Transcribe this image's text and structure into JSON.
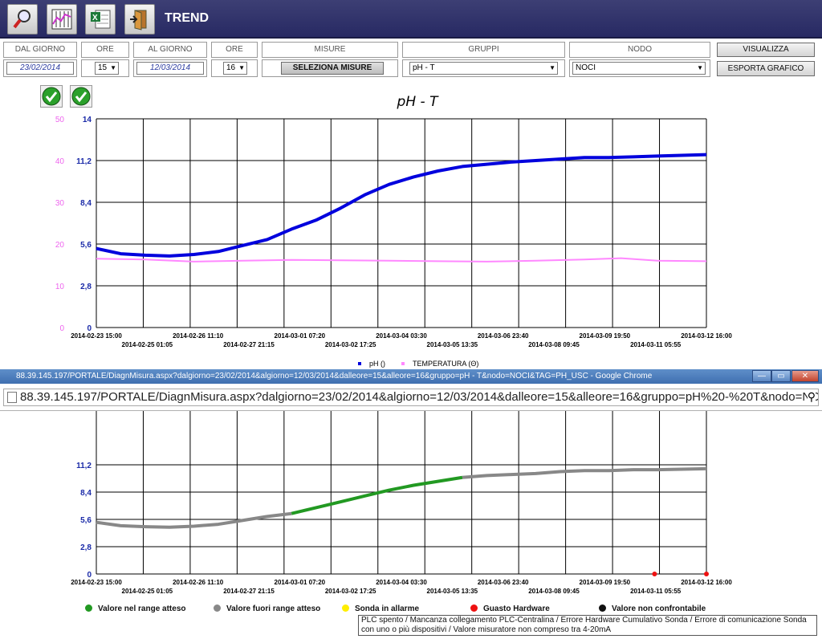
{
  "header": {
    "title": "TREND"
  },
  "filters": {
    "dal_giorno_label": "DAL GIORNO",
    "ore_label_1": "ORE",
    "al_giorno_label": "AL GIORNO",
    "ore_label_2": "ORE",
    "misure_label": "MISURE",
    "gruppi_label": "GRUPPI",
    "nodo_label": "NODO",
    "dal_giorno_value": "23/02/2014",
    "ore_value_1": "15",
    "al_giorno_value": "12/03/2014",
    "ore_value_2": "16",
    "seleziona_misure": "SELEZIONA MISURE",
    "gruppo_value": "pH - T",
    "nodo_value": "NOCI",
    "visualizza": "VISUALIZZA",
    "esporta": "ESPORTA GRAFICO"
  },
  "chart_data": [
    {
      "type": "line",
      "title": "pH - T",
      "left_axis_pink": [
        "50",
        "40",
        "30",
        "20",
        "10",
        "0"
      ],
      "y_ticks": [
        "14",
        "11,2",
        "8,4",
        "5,6",
        "2,8",
        "0"
      ],
      "ylim": [
        0,
        14
      ],
      "y2lim": [
        0,
        50
      ],
      "x_ticks_row1": [
        "2014-02-23 15:00",
        "2014-02-26 11:10",
        "2014-03-01 07:20",
        "2014-03-04 03:30",
        "2014-03-06 23:40",
        "2014-03-09 19:50",
        "2014-03-12 16:00"
      ],
      "x_ticks_row2": [
        "2014-02-25 01:05",
        "2014-02-27 21:15",
        "2014-03-02 17:25",
        "2014-03-05 13:35",
        "2014-03-08 09:45",
        "2014-03-11 05:55"
      ],
      "series": [
        {
          "name": "pH ()",
          "color": "#0000dd",
          "x": [
            0,
            0.04,
            0.08,
            0.12,
            0.16,
            0.2,
            0.24,
            0.28,
            0.32,
            0.36,
            0.4,
            0.44,
            0.48,
            0.52,
            0.56,
            0.6,
            0.64,
            0.68,
            0.72,
            0.76,
            0.8,
            0.84,
            0.88,
            0.92,
            0.96,
            1.0
          ],
          "values": [
            5.3,
            4.95,
            4.85,
            4.8,
            4.9,
            5.1,
            5.5,
            5.9,
            6.6,
            7.2,
            8.0,
            8.9,
            9.6,
            10.1,
            10.5,
            10.8,
            10.95,
            11.1,
            11.2,
            11.3,
            11.4,
            11.4,
            11.45,
            11.5,
            11.55,
            11.6
          ]
        },
        {
          "name": "TEMPERATURA (Θ)",
          "color": "#ff88ff",
          "x": [
            0,
            0.08,
            0.16,
            0.24,
            0.32,
            0.4,
            0.48,
            0.56,
            0.64,
            0.72,
            0.8,
            0.86,
            0.92,
            1.0
          ],
          "values": [
            16.5,
            16.3,
            15.8,
            16.0,
            16.2,
            16.1,
            16.0,
            15.9,
            15.8,
            16.0,
            16.3,
            16.6,
            16.0,
            15.9
          ]
        }
      ]
    },
    {
      "type": "line",
      "title": "",
      "y_ticks": [
        "11,2",
        "8,4",
        "5,6",
        "2,8",
        "0"
      ],
      "ylim": [
        0,
        14
      ],
      "x_ticks_row1": [
        "2014-02-23 15:00",
        "2014-02-26 11:10",
        "2014-03-01 07:20",
        "2014-03-04 03:30",
        "2014-03-06 23:40",
        "2014-03-09 19:50",
        "2014-03-12 16:00"
      ],
      "x_ticks_row2": [
        "2014-02-25 01:05",
        "2014-02-27 21:15",
        "2014-03-02 17:25",
        "2014-03-05 13:35",
        "2014-03-08 09:45",
        "2014-03-11 05:55"
      ],
      "series": [
        {
          "name": "Valore fuori range atteso",
          "color": "#888888",
          "x": [
            0,
            0.04,
            0.08,
            0.12,
            0.16,
            0.2,
            0.24,
            0.28,
            0.32
          ],
          "values": [
            5.3,
            4.95,
            4.85,
            4.8,
            4.9,
            5.1,
            5.5,
            5.9,
            6.2
          ]
        },
        {
          "name": "Valore nel range atteso",
          "color": "#229922",
          "x": [
            0.32,
            0.36,
            0.4,
            0.44,
            0.48,
            0.52,
            0.56,
            0.6
          ],
          "values": [
            6.2,
            6.8,
            7.4,
            8.0,
            8.6,
            9.1,
            9.5,
            9.9
          ]
        },
        {
          "name": "Valore fuori range atteso",
          "color": "#888888",
          "x": [
            0.6,
            0.64,
            0.68,
            0.72,
            0.76,
            0.8,
            0.84,
            0.88,
            0.92,
            0.96,
            1.0
          ],
          "values": [
            9.9,
            10.1,
            10.2,
            10.3,
            10.5,
            10.6,
            10.6,
            10.7,
            10.7,
            10.75,
            10.8
          ]
        },
        {
          "name": "Guasto Hardware",
          "color": "#ee1111",
          "x": [
            0.915,
            1.0
          ],
          "values": [
            0,
            0
          ]
        }
      ]
    }
  ],
  "legend_top": [
    {
      "label": "pH ()",
      "color": "#0000dd"
    },
    {
      "label": "TEMPERATURA (Θ)",
      "color": "#ff88ff"
    }
  ],
  "browser": {
    "title": "88.39.145.197/PORTALE/DiagnMisura.aspx?dalgiorno=23/02/2014&algiorno=12/03/2014&dalleore=15&alleore=16&gruppo=pH - T&nodo=NOCI&TAG=PH_USC - Google Chrome",
    "url": "88.39.145.197/PORTALE/DiagnMisura.aspx?dalgiorno=23/02/2014&algiorno=12/03/2014&dalleore=15&alleore=16&gruppo=pH%20-%20T&nodo=NOCI"
  },
  "legend_bottom": [
    {
      "label": "Valore nel range atteso",
      "color": "#229922"
    },
    {
      "label": "Valore fuori range atteso",
      "color": "#888888"
    },
    {
      "label": "Sonda in allarme",
      "color": "#ffee00"
    },
    {
      "label": "Guasto Hardware",
      "color": "#ee1111"
    },
    {
      "label": "Valore non confrontabile",
      "color": "#111111"
    }
  ],
  "tooltip": "PLC spento / Mancanza collegamento PLC-Centralina / Errore Hardware Cumulativo Sonda / Errore di comunicazione Sonda con uno o più dispositivi / Valore misuratore non compreso tra 4-20mA"
}
